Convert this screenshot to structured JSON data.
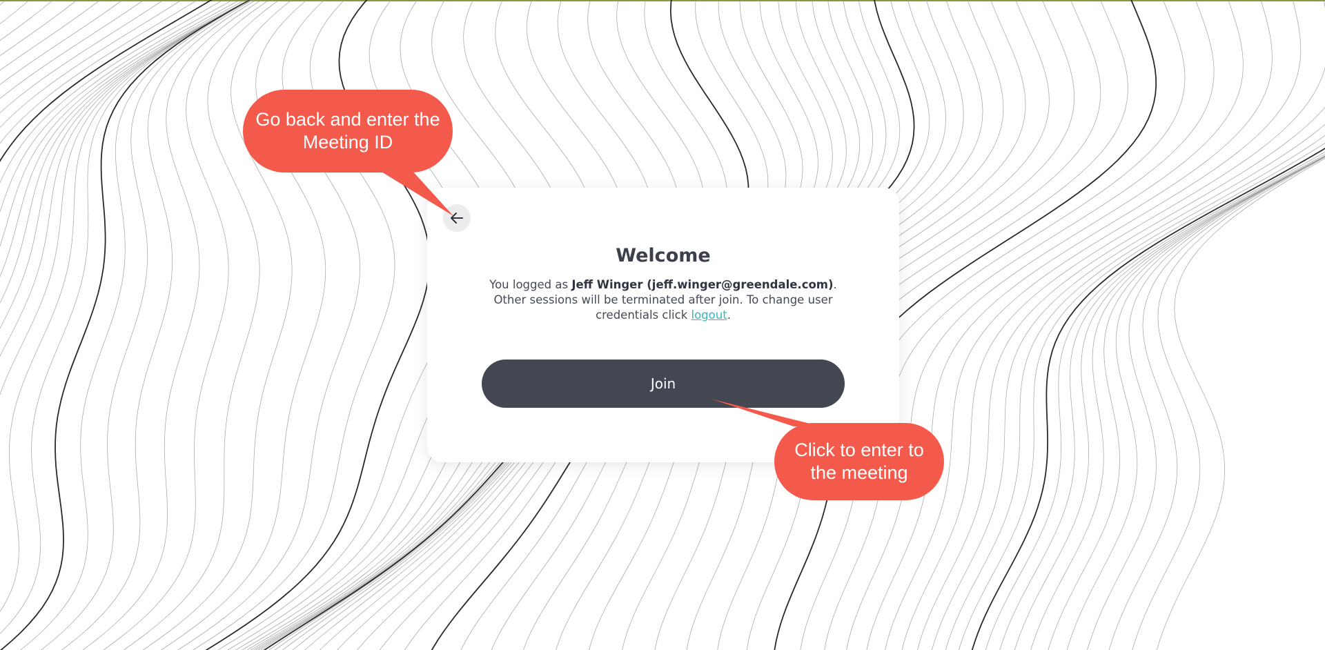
{
  "welcome": {
    "title": "Welcome",
    "message_prefix": "You logged as ",
    "user_display": "Jeff Winger (jeff.winger@greendale.com)",
    "message_middle": ". Other sessions will be terminated after join. To change user credentials click ",
    "logout_label": "logout",
    "message_suffix": ".",
    "join_label": "Join",
    "back_icon": "arrow-left-icon"
  },
  "annotations": {
    "back_callout": "Go back and enter the Meeting ID",
    "join_callout": "Click to enter to the meeting"
  },
  "colors": {
    "join_button": "#434752",
    "callout": "#f45a4b",
    "link": "#3ab5b8"
  }
}
